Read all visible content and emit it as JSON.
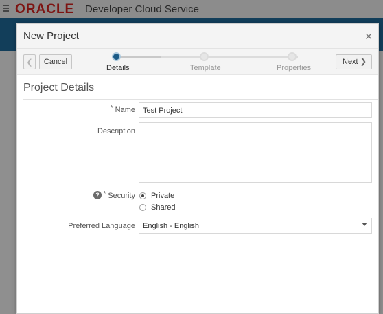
{
  "app": {
    "logo": "ORACLE",
    "title": "Developer Cloud Service"
  },
  "dialog": {
    "title": "New Project",
    "close_icon": "close-icon"
  },
  "train": {
    "prev_icon": "chevron-left-icon",
    "cancel_label": "Cancel",
    "next_label": "Next",
    "next_icon": "chevron-right-icon",
    "steps": [
      {
        "label": "Details",
        "active": true
      },
      {
        "label": "Template",
        "active": false
      },
      {
        "label": "Properties",
        "active": false
      }
    ]
  },
  "form": {
    "section_title": "Project Details",
    "name": {
      "label": "Name",
      "required": "*",
      "value": "Test Project"
    },
    "description": {
      "label": "Description",
      "value": ""
    },
    "security": {
      "label": "Security",
      "required": "*",
      "help_icon": "help-icon",
      "options": [
        {
          "label": "Private",
          "checked": true
        },
        {
          "label": "Shared",
          "checked": false
        }
      ]
    },
    "language": {
      "label": "Preferred Language",
      "value": "English - English"
    }
  },
  "colors": {
    "accent": "#1b5a86",
    "brand": "#d8231f",
    "header_blue": "#1f6c9c"
  }
}
